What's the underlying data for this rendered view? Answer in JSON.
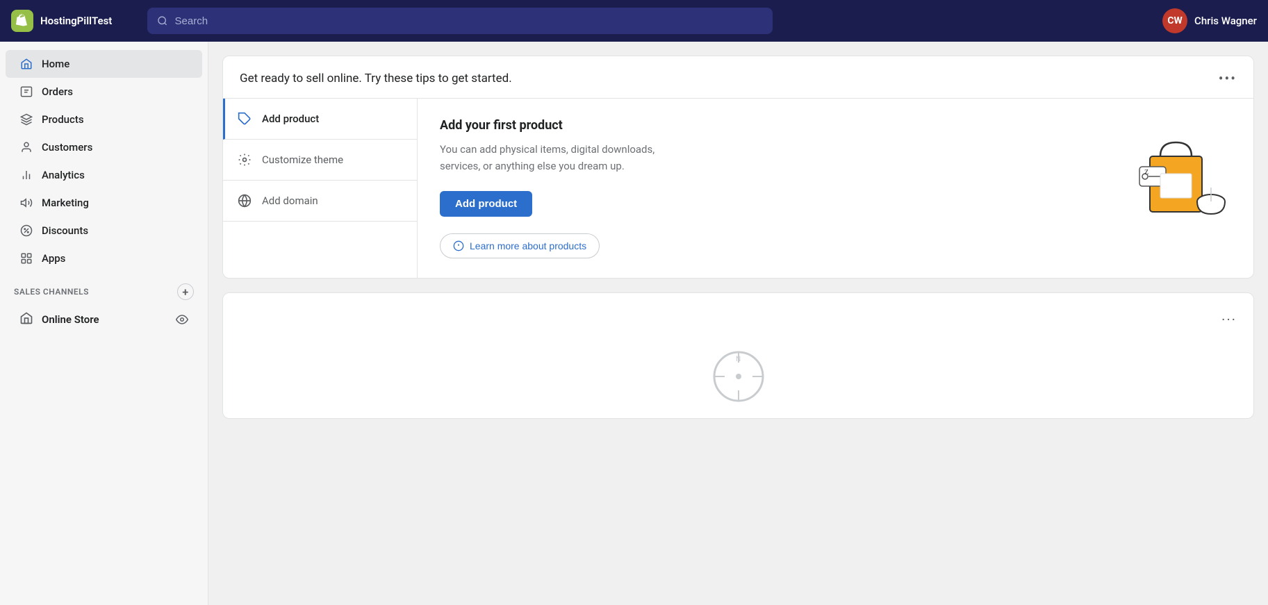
{
  "brand": {
    "logo_letter": "S",
    "store_name": "HostingPillTest"
  },
  "search": {
    "placeholder": "Search"
  },
  "user": {
    "initials": "CW",
    "name": "Chris Wagner"
  },
  "sidebar": {
    "items": [
      {
        "id": "home",
        "label": "Home",
        "icon": "home-icon",
        "active": true
      },
      {
        "id": "orders",
        "label": "Orders",
        "icon": "orders-icon",
        "active": false
      },
      {
        "id": "products",
        "label": "Products",
        "icon": "products-icon",
        "active": false
      },
      {
        "id": "customers",
        "label": "Customers",
        "icon": "customers-icon",
        "active": false
      },
      {
        "id": "analytics",
        "label": "Analytics",
        "icon": "analytics-icon",
        "active": false
      },
      {
        "id": "marketing",
        "label": "Marketing",
        "icon": "marketing-icon",
        "active": false
      },
      {
        "id": "discounts",
        "label": "Discounts",
        "icon": "discounts-icon",
        "active": false
      },
      {
        "id": "apps",
        "label": "Apps",
        "icon": "apps-icon",
        "active": false
      }
    ],
    "sales_channels_label": "SALES CHANNELS",
    "online_store_label": "Online Store"
  },
  "main_card": {
    "title": "Get ready to sell online. Try these tips to get started.",
    "more_options_label": "...",
    "tips": [
      {
        "id": "add-product",
        "label": "Add product",
        "icon": "tag-icon",
        "active": true
      },
      {
        "id": "customize-theme",
        "label": "Customize theme",
        "icon": "theme-icon",
        "active": false
      },
      {
        "id": "add-domain",
        "label": "Add domain",
        "icon": "domain-icon",
        "active": false
      }
    ],
    "detail": {
      "title": "Add your first product",
      "description": "You can add physical items, digital downloads, services, or anything else you dream up.",
      "action_label": "Add product",
      "learn_more_label": "Learn more about products"
    }
  },
  "second_card": {
    "more_options_label": "..."
  }
}
